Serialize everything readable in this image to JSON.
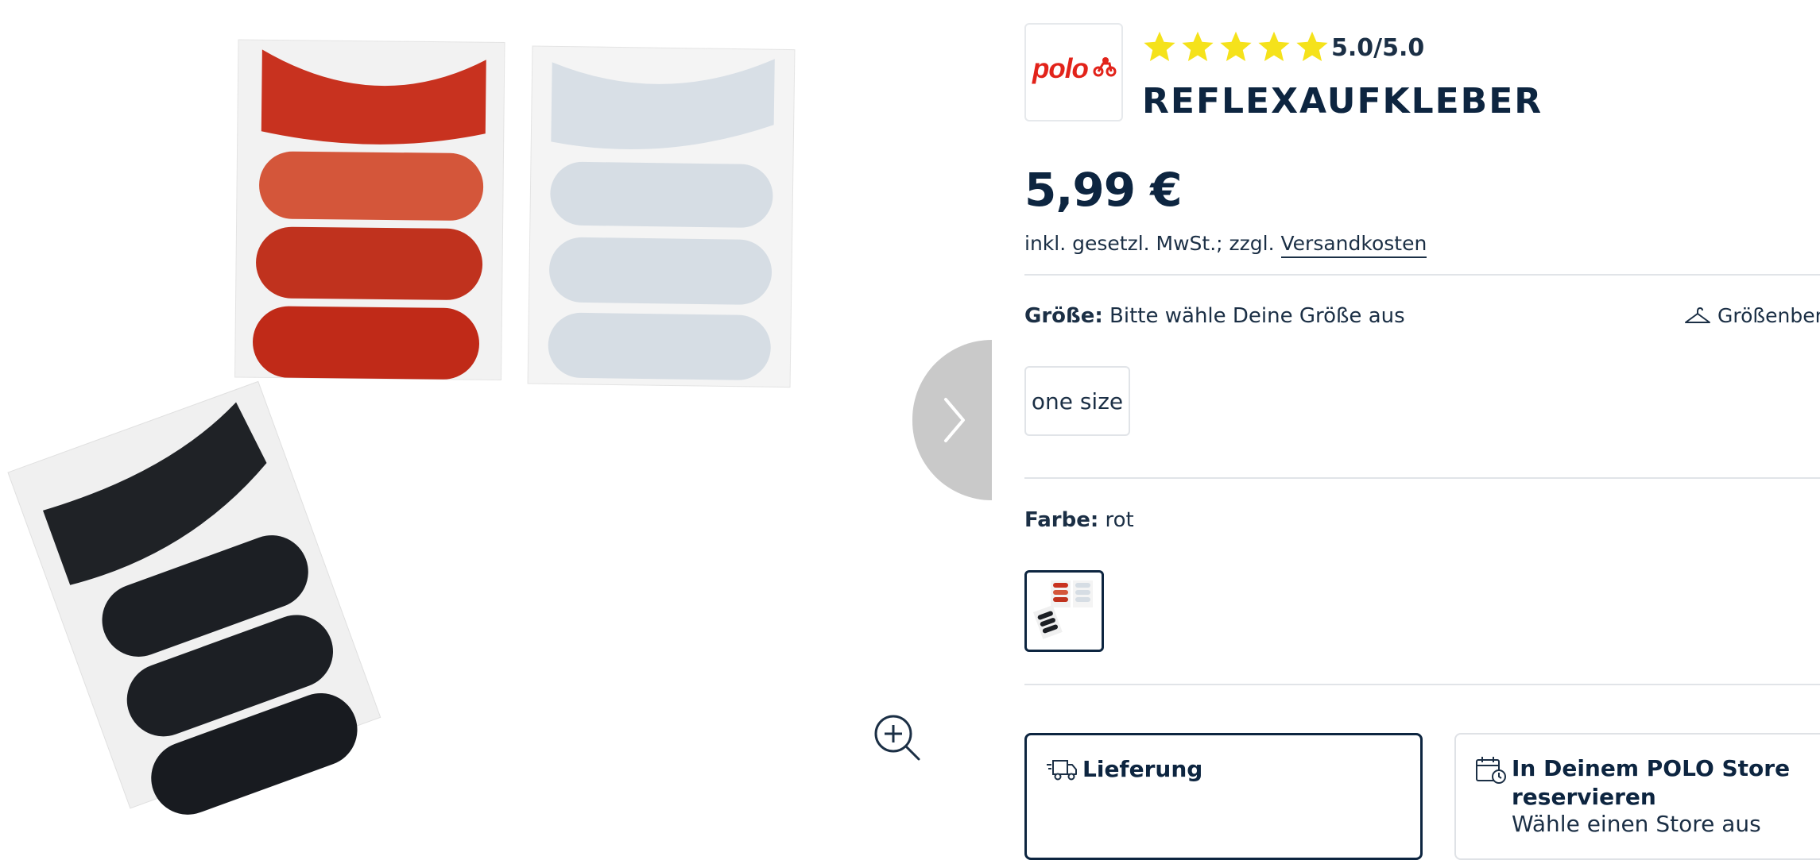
{
  "gallery": {
    "next_label": "chevron-right-icon",
    "zoom_label": "zoom-in-icon"
  },
  "product": {
    "brand": "polo",
    "rating": "5.0/5.0",
    "stars": 5,
    "title": "REFLEXAUFKLEBER",
    "price": "5,99 €",
    "tax_note": "inkl. gesetzl. MwSt.; zzgl.",
    "shipping_link": "Versandkosten"
  },
  "size": {
    "label": "Größe:",
    "prompt": "Bitte wähle Deine Größe aus",
    "guide": "Größenberater",
    "options": [
      "one size"
    ]
  },
  "color": {
    "label": "Farbe:",
    "value": "rot"
  },
  "fulfillment": {
    "delivery_title": "Lieferung",
    "store_title": "In Deinem POLO Store reservieren",
    "store_sub": "Wähle einen Store aus"
  },
  "colors": {
    "navy": "#0d2540",
    "text": "#1b2f45",
    "brand_red": "#e2231a",
    "star_yellow": "#f5e21b",
    "border": "#e1e4e8"
  }
}
